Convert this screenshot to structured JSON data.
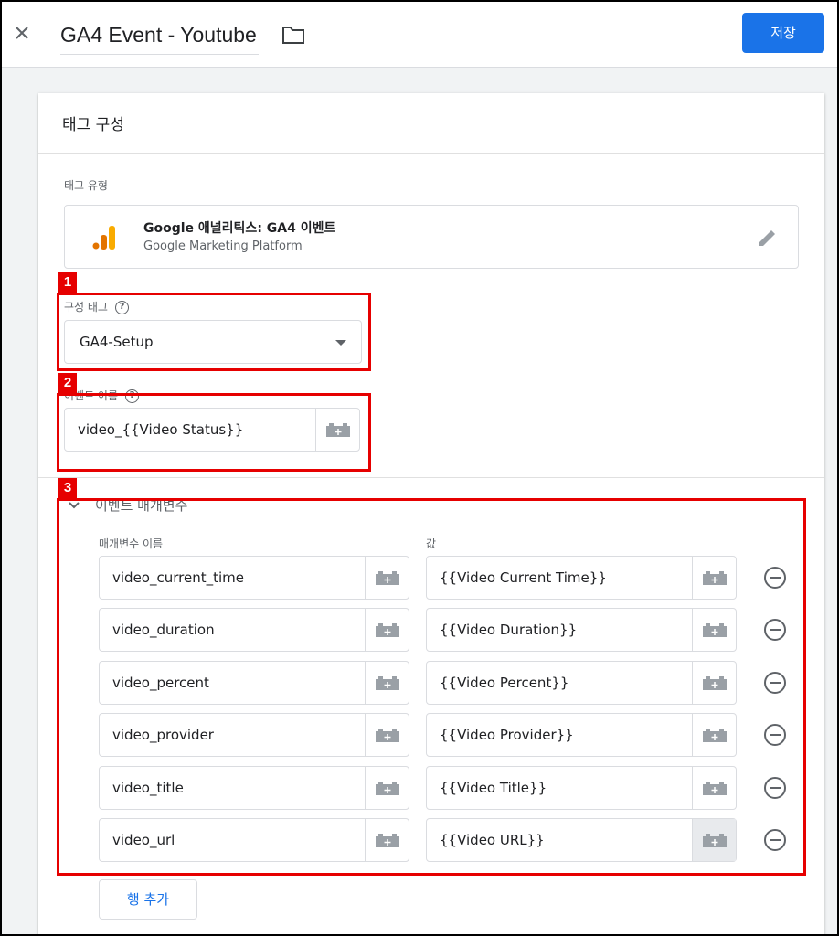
{
  "header": {
    "title": "GA4 Event - Youtube",
    "save_label": "저장"
  },
  "card": {
    "title": "태그 구성",
    "tag_type_label": "태그 유형",
    "tag_type": {
      "name": "Google 애널리틱스: GA4 이벤트",
      "sub": "Google Marketing Platform"
    },
    "config_tag_label": "구성 태그",
    "config_tag_value": "GA4-Setup",
    "event_name_label": "이벤트 이름",
    "event_name_value": "video_{{Video Status}}",
    "params_section_label": "이벤트 매개변수",
    "param_name_header": "매개변수 이름",
    "param_value_header": "값",
    "params": [
      {
        "name": "video_current_time",
        "value": "{{Video Current Time}}"
      },
      {
        "name": "video_duration",
        "value": "{{Video Duration}}"
      },
      {
        "name": "video_percent",
        "value": "{{Video Percent}}"
      },
      {
        "name": "video_provider",
        "value": "{{Video Provider}}"
      },
      {
        "name": "video_title",
        "value": "{{Video Title}}"
      },
      {
        "name": "video_url",
        "value": "{{Video URL}}"
      }
    ],
    "add_row_label": "행 추가"
  },
  "annotations": [
    "1",
    "2",
    "3"
  ],
  "colors": {
    "primary": "#1a73e8",
    "annotation": "#e60000",
    "ga_orange": "#f9ab00",
    "ga_dark_orange": "#e37400"
  }
}
